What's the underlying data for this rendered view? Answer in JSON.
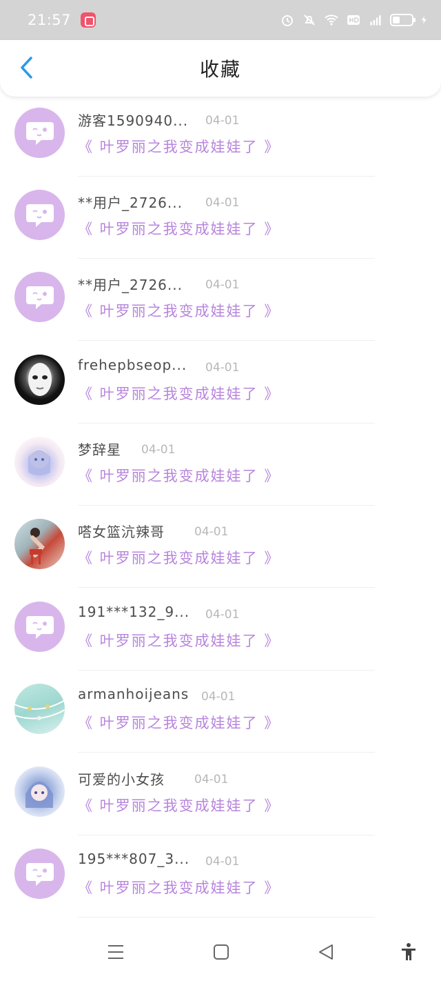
{
  "status_bar": {
    "time": "21:57",
    "icons": [
      "app-badge-icon",
      "alarm-icon",
      "mute-icon",
      "wifi-icon",
      "hd-icon",
      "4g-signal-icon",
      "battery-icon",
      "charging-icon"
    ]
  },
  "header": {
    "title": "收藏",
    "back_icon": "chevron-left-icon"
  },
  "favorites": [
    {
      "username": "游客1590940...",
      "date": "04-01",
      "title": "《 叶罗丽之我变成娃娃了 》",
      "avatar": "chat-bubble"
    },
    {
      "username": "**用户_2726...",
      "date": "04-01",
      "title": "《 叶罗丽之我变成娃娃了 》",
      "avatar": "chat-bubble"
    },
    {
      "username": "**用户_2726...",
      "date": "04-01",
      "title": "《 叶罗丽之我变成娃娃了 》",
      "avatar": "chat-bubble"
    },
    {
      "username": "frehepbseop...",
      "date": "04-01",
      "title": "《 叶罗丽之我变成娃娃了 》",
      "avatar": "mask-photo"
    },
    {
      "username": "梦辞星",
      "date": "04-01",
      "title": "《 叶罗丽之我变成娃娃了 》",
      "avatar": "anime-girl-photo"
    },
    {
      "username": "嗒女篮沆辣哥",
      "date": "04-01",
      "title": "《 叶罗丽之我变成娃娃了 》",
      "avatar": "pinup-photo"
    },
    {
      "username": "191***132_9...",
      "date": "04-01",
      "title": "《 叶罗丽之我变成娃娃了 》",
      "avatar": "chat-bubble"
    },
    {
      "username": "armanhoijeans",
      "date": "04-01",
      "title": "《 叶罗丽之我变成娃娃了 》",
      "avatar": "beads-photo"
    },
    {
      "username": "可爱的小女孩",
      "date": "04-01",
      "title": "《 叶罗丽之我变成娃娃了 》",
      "avatar": "anime-blue-photo"
    },
    {
      "username": "195***807_3...",
      "date": "04-01",
      "title": "《 叶罗丽之我变成娃娃了 》",
      "avatar": "chat-bubble"
    }
  ],
  "system_nav": {
    "icons": [
      "menu-icon",
      "home-square-icon",
      "back-triangle-icon",
      "accessibility-icon"
    ]
  },
  "colors": {
    "accent_blue": "#2b9be8",
    "title_purple": "#b784dd",
    "avatar_purple": "#d8b6ec",
    "status_bar_gray": "#d4d4d4"
  }
}
